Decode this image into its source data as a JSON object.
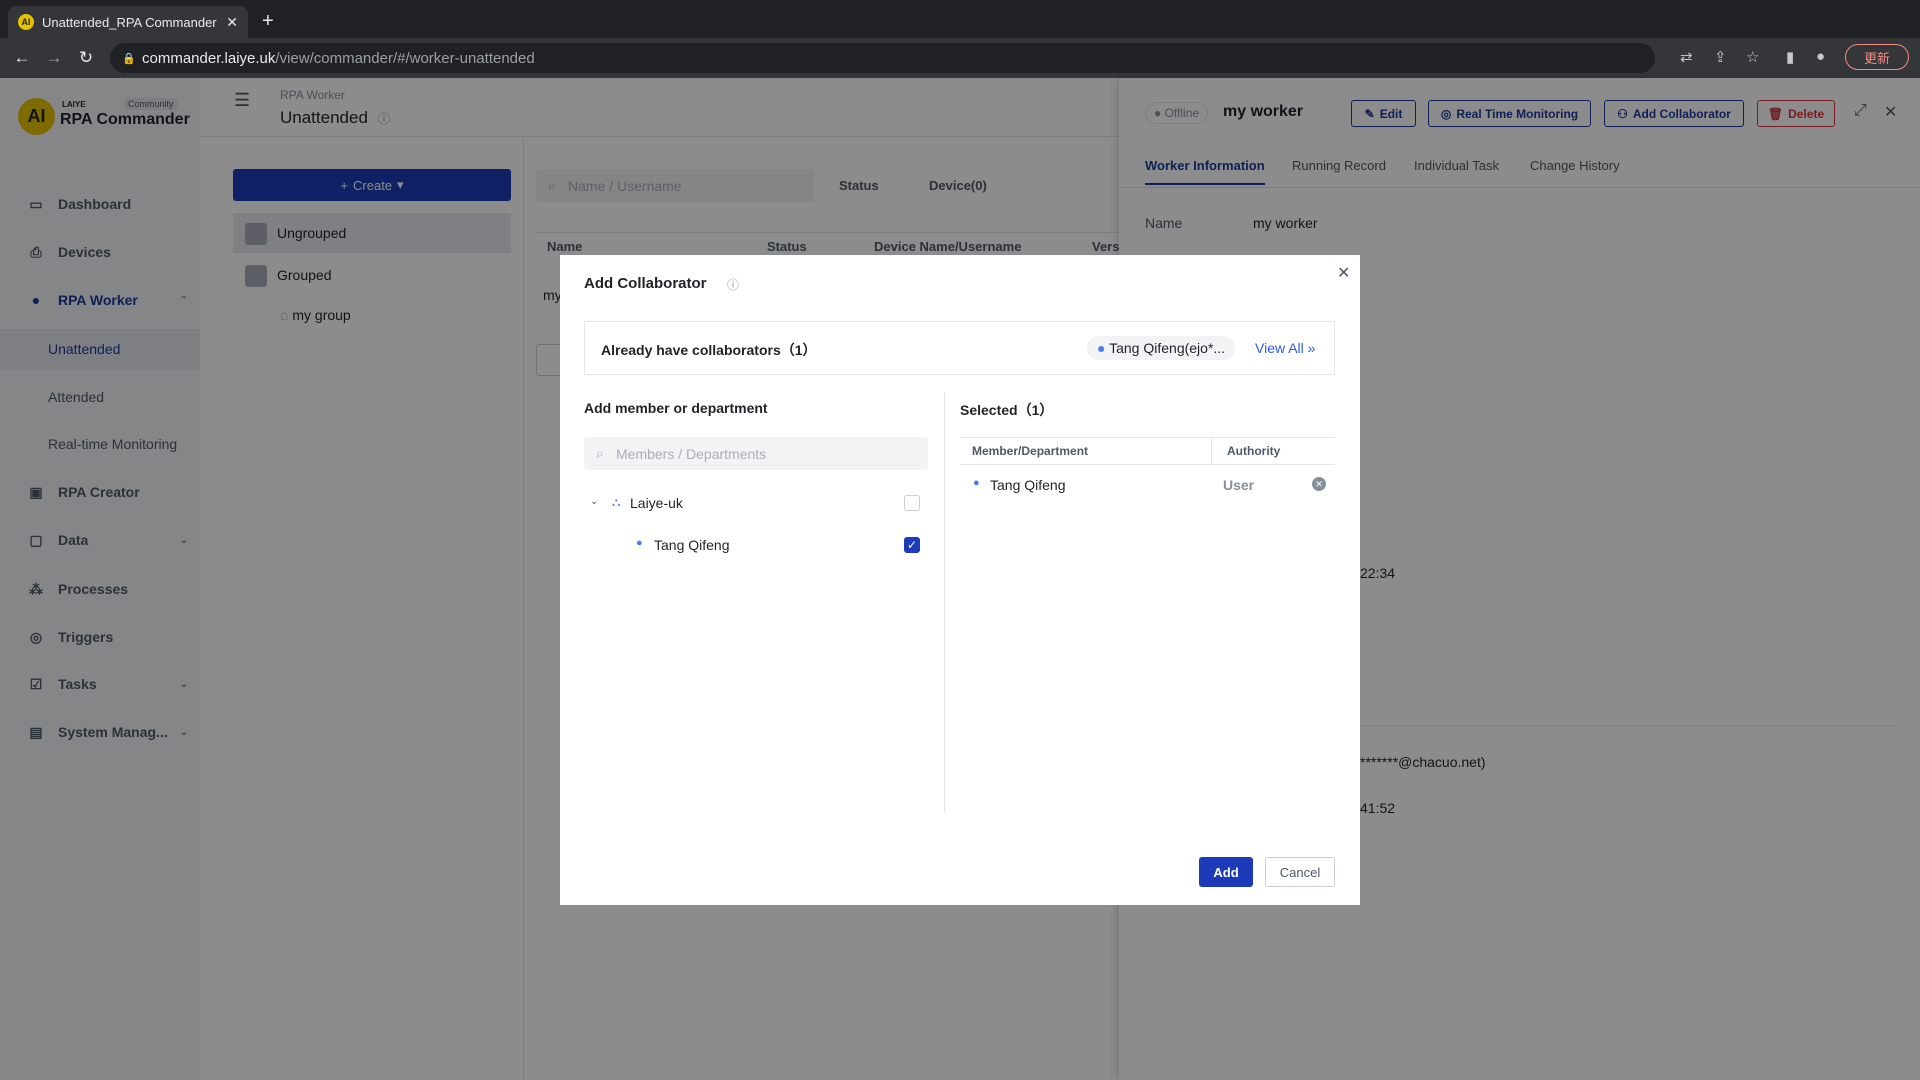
{
  "browser": {
    "tab_title": "Unattended_RPA Commander",
    "url_host": "commander.laiye.uk",
    "url_path": "/view/commander/#/worker-unattended",
    "update_label": "更新"
  },
  "brand": {
    "logo_text": "AI",
    "company": "LAIYE",
    "edition": "Community",
    "product": "RPA Commander"
  },
  "sidebar": {
    "items": [
      {
        "label": "Dashboard",
        "icon": "monitor-icon"
      },
      {
        "label": "Devices",
        "icon": "device-icon"
      },
      {
        "label": "RPA Worker",
        "icon": "robot-icon",
        "expanded": true,
        "active": true
      },
      {
        "label": "Unattended",
        "sub": true,
        "active": true
      },
      {
        "label": "Attended",
        "sub": true
      },
      {
        "label": "Real-time Monitoring",
        "sub": true
      },
      {
        "label": "RPA Creator",
        "icon": "terminal-icon"
      },
      {
        "label": "Data",
        "icon": "folder-icon",
        "chevron": true
      },
      {
        "label": "Processes",
        "icon": "process-icon"
      },
      {
        "label": "Triggers",
        "icon": "trigger-icon"
      },
      {
        "label": "Tasks",
        "icon": "task-icon",
        "chevron": true
      },
      {
        "label": "System Manag...",
        "icon": "system-icon",
        "chevron": true
      }
    ]
  },
  "header": {
    "breadcrumb": "RPA Worker",
    "title": "Unattended"
  },
  "main": {
    "create_label": "Create",
    "groups": [
      {
        "label": "Ungrouped"
      },
      {
        "label": "Grouped"
      },
      {
        "label": "my group"
      }
    ],
    "search_placeholder": "Name / Username",
    "filters": [
      "Status",
      "Device(0)"
    ],
    "columns": [
      "Name",
      "Status",
      "Device Name/Username",
      "Vers"
    ],
    "row_name": "my"
  },
  "drawer": {
    "status": "Offline",
    "title": "my worker",
    "buttons": [
      "Edit",
      "Real Time Monitoring",
      "Add Collaborator",
      "Delete"
    ],
    "tabs": [
      "Worker Information",
      "Running Record",
      "Individual Task",
      "Change History"
    ],
    "active_tab": 0,
    "name_label": "Name",
    "name_value": "my worker",
    "value_1": "22:34",
    "value_2": "*******@chacuo.net)",
    "value_3": "41:52"
  },
  "modal": {
    "title": "Add Collaborator",
    "existing_label": "Already have collaborators（1）",
    "existing_chip": "Tang Qifeng(ejo*...",
    "view_all": "View All »",
    "left_title": "Add member or department",
    "search_placeholder": "Members / Departments",
    "tree": [
      {
        "label": "Laiye-uk",
        "type": "department",
        "checked": false
      },
      {
        "label": "Tang Qifeng",
        "type": "member",
        "checked": true
      }
    ],
    "selected_title": "Selected（1）",
    "columns": [
      "Member/Department",
      "Authority"
    ],
    "selected": [
      {
        "name": "Tang Qifeng",
        "authority": "User"
      }
    ],
    "add_label": "Add",
    "cancel_label": "Cancel"
  },
  "colors": {
    "primary": "#1d3bb8",
    "danger": "#d9363e",
    "link": "#2b5ce6"
  }
}
